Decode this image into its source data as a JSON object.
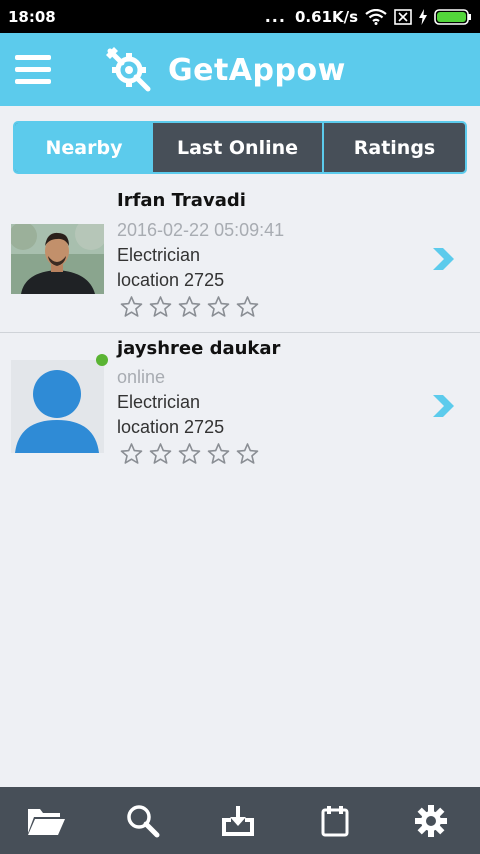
{
  "status_bar": {
    "time": "18:08",
    "dots": "...",
    "network_speed": "0.61K/s",
    "icons": [
      "wifi-icon",
      "sim-none-icon",
      "charging-icon",
      "battery-icon"
    ]
  },
  "header": {
    "title": "GetAppow",
    "menu_icon": "hamburger-menu-icon",
    "logo_icon": "wrench-gear-logo-icon",
    "background": "#5ccbec"
  },
  "tabs": [
    {
      "label": "Nearby",
      "active": true
    },
    {
      "label": "Last Online",
      "active": false
    },
    {
      "label": "Ratings",
      "active": false
    }
  ],
  "listings": [
    {
      "name": "Irfan Travadi",
      "status": "2016-02-22 05:09:41",
      "profession": "Electrician",
      "location": "location 2725",
      "rating": 0,
      "max_rating": 5,
      "avatar": "photo",
      "online": false
    },
    {
      "name": "jayshree daukar",
      "status": "online",
      "profession": "Electrician",
      "location": "location 2725",
      "rating": 0,
      "max_rating": 5,
      "avatar": "default-person",
      "online": true
    }
  ],
  "bottom_nav": [
    {
      "icon": "folder-icon"
    },
    {
      "icon": "search-icon"
    },
    {
      "icon": "inbox-download-icon"
    },
    {
      "icon": "calendar-icon"
    },
    {
      "icon": "settings-gear-icon"
    }
  ],
  "colors": {
    "accent": "#5ccbec",
    "dark": "#474f58",
    "online": "#5ab433"
  }
}
